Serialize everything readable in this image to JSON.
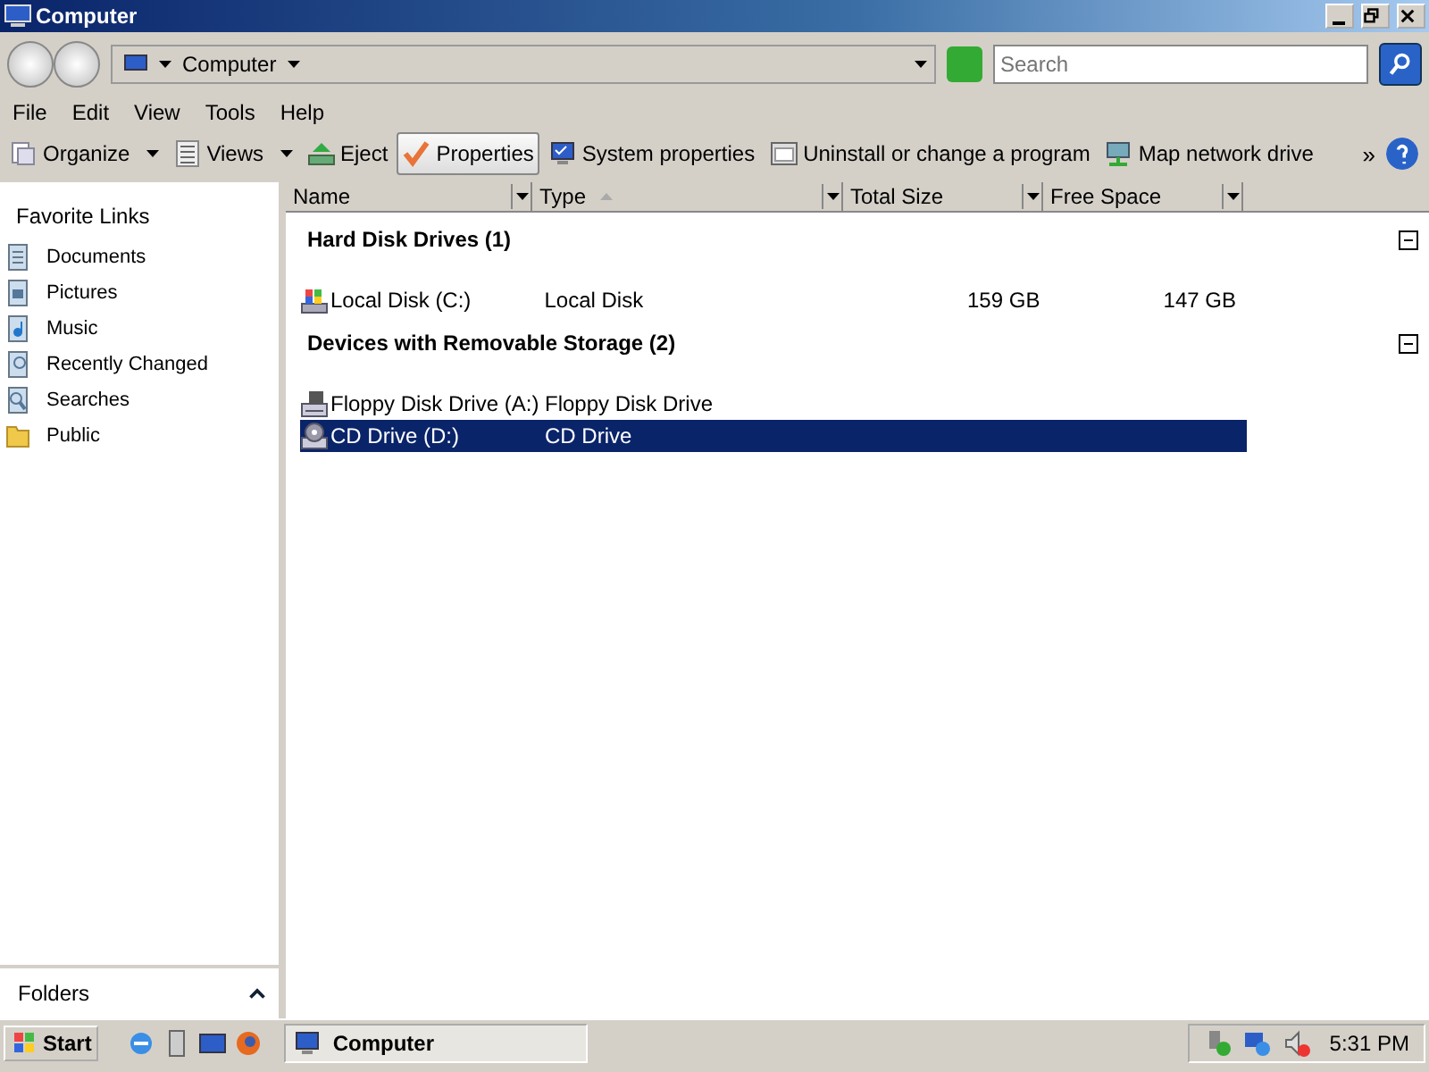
{
  "window": {
    "title": "Computer"
  },
  "address_bar": {
    "path": "Computer",
    "search": {
      "placeholder": "Search"
    }
  },
  "menu": [
    "File",
    "Edit",
    "View",
    "Tools",
    "Help"
  ],
  "toolbar": [
    {
      "label": "Organize",
      "dropdown": true,
      "hovered": false
    },
    {
      "label": "Views",
      "dropdown": true,
      "hovered": false
    },
    {
      "label": "Eject",
      "dropdown": false,
      "hovered": false
    },
    {
      "label": "Properties",
      "dropdown": false,
      "hovered": true
    },
    {
      "label": "System properties",
      "dropdown": false,
      "hovered": false
    },
    {
      "label": "Uninstall or change a program",
      "dropdown": false,
      "hovered": false
    },
    {
      "label": "Map network drive",
      "dropdown": false,
      "hovered": false
    }
  ],
  "toolbar_more": "»",
  "sidebar": {
    "heading": "Favorite Links",
    "items": [
      "Documents",
      "Pictures",
      "Music",
      "Recently Changed",
      "Searches",
      "Public"
    ],
    "folders": "Folders"
  },
  "table": {
    "columns": [
      {
        "label": "Name",
        "sorted": false
      },
      {
        "label": "Type",
        "sorted": true
      },
      {
        "label": "Total Size",
        "sorted": false
      },
      {
        "label": "Free Space",
        "sorted": false
      }
    ],
    "groups": [
      {
        "title": "Hard Disk Drives (1)",
        "expanded": true,
        "rows": [
          {
            "name": "Local Disk (C:)",
            "type": "Local Disk",
            "total": "159 GB",
            "free": "147 GB",
            "selected": false
          }
        ]
      },
      {
        "title": "Devices with Removable Storage (2)",
        "expanded": true,
        "rows": [
          {
            "name": "Floppy Disk Drive (A:)",
            "type": "Floppy Disk Drive",
            "selected": false
          },
          {
            "name": "CD Drive (D:)",
            "type": "CD Drive",
            "selected": true
          }
        ]
      }
    ]
  },
  "taskbar": {
    "start": "Start",
    "tasks": [
      {
        "label": "Computer",
        "selected": true
      }
    ],
    "clock": "5:31 PM"
  }
}
